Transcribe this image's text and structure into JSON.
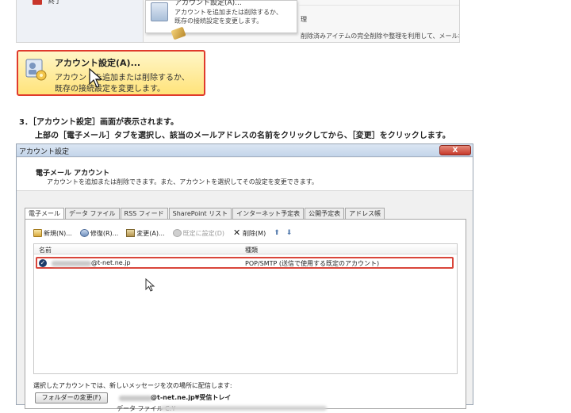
{
  "top_screenshot": {
    "left_menu": {
      "exit_label": "終了"
    },
    "popup": {
      "title": "アカウント設定(A)...",
      "line1": "アカウントを追加または削除するか、",
      "line2": "既存の接続設定を変更します。"
    },
    "right": {
      "text1": "理",
      "text2": "削除済みアイテムの完全削除や整理を利用して、メールボックスのサイ"
    }
  },
  "account_button": {
    "title": "アカウント設定(A)...",
    "line1": "アカウントを追加または削除するか、",
    "line2": "既存の接続設定を変更します。",
    "accent_border": "#e03a2c",
    "bg": "#ffe37a"
  },
  "instructions": {
    "step": "3．［アカウント設定］画面が表示されます。",
    "detail": "上部の［電子メール］タブを選択し、該当のメールアドレスの名前をクリックしてから、［変更］をクリックします。"
  },
  "dialog": {
    "title": "アカウント設定",
    "close_label": "X",
    "header_title": "電子メール アカウント",
    "header_sub": "アカウントを追加または削除できます。また、アカウントを選択してその設定を変更できます。",
    "tabs": [
      {
        "label": "電子メール",
        "active": true
      },
      {
        "label": "データ ファイル",
        "active": false
      },
      {
        "label": "RSS フィード",
        "active": false
      },
      {
        "label": "SharePoint リスト",
        "active": false
      },
      {
        "label": "インターネット予定表",
        "active": false
      },
      {
        "label": "公開予定表",
        "active": false
      },
      {
        "label": "アドレス帳",
        "active": false
      }
    ],
    "toolbar": {
      "new": "新規(N)...",
      "repair": "修復(R)...",
      "change": "変更(A)...",
      "default": "既定に設定(D)",
      "delete": "削除(M)",
      "up_arrow": "⬆",
      "down_arrow": "⬇"
    },
    "list": {
      "col_name": "名前",
      "col_type": "種類",
      "rows": [
        {
          "name": "@t-net.ne.jp",
          "type": "POP/SMTP (送信で使用する既定のアカウント)"
        }
      ],
      "highlight_color": "#d9453a"
    },
    "deliver_label": "選択したアカウントでは、新しいメッセージを次の場所に配信します:",
    "folder_button": "フォルダーの変更(F)",
    "deliver_path": "@t-net.ne.jp¥受信トレイ",
    "datafile_label": "データ ファイル C:¥"
  }
}
